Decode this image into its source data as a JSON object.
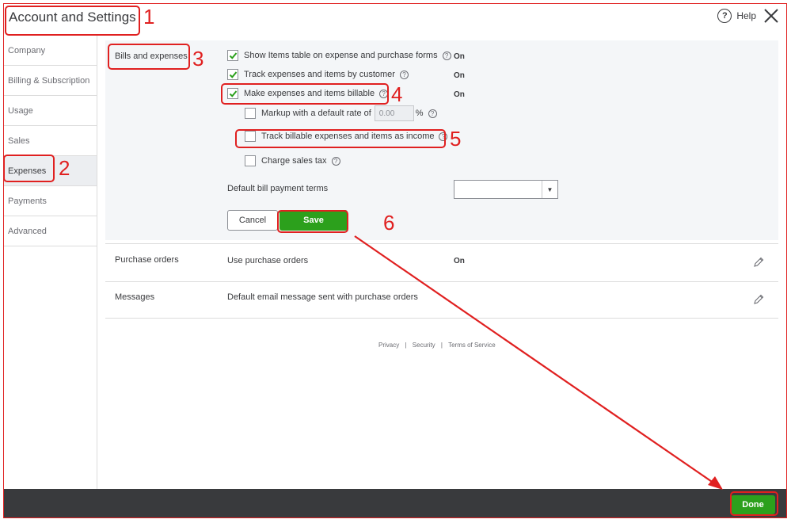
{
  "header": {
    "title": "Account and Settings",
    "help_label": "Help"
  },
  "sidebar": {
    "items": [
      {
        "label": "Company"
      },
      {
        "label": "Billing & Subscription"
      },
      {
        "label": "Usage"
      },
      {
        "label": "Sales"
      },
      {
        "label": "Expenses"
      },
      {
        "label": "Payments"
      },
      {
        "label": "Advanced"
      }
    ]
  },
  "bills": {
    "section_label": "Bills and expenses",
    "show_items": {
      "label": "Show Items table on expense and purchase forms",
      "status": "On",
      "checked": true
    },
    "track_by_customer": {
      "label": "Track expenses and items by customer",
      "status": "On",
      "checked": true
    },
    "make_billable": {
      "label": "Make expenses and items billable",
      "status": "On",
      "checked": true
    },
    "markup": {
      "label": "Markup with a default rate of",
      "value": "0.00",
      "unit": "%",
      "checked": false
    },
    "track_as_income": {
      "label": "Track billable expenses and items as income",
      "checked": false
    },
    "charge_tax": {
      "label": "Charge sales tax",
      "checked": false
    },
    "payment_terms": {
      "label": "Default bill payment terms",
      "value": ""
    },
    "cancel_label": "Cancel",
    "save_label": "Save"
  },
  "purchase_orders": {
    "section_label": "Purchase orders",
    "label": "Use purchase orders",
    "status": "On"
  },
  "messages": {
    "section_label": "Messages",
    "label": "Default email message sent with purchase orders"
  },
  "footer": {
    "privacy": "Privacy",
    "sep": "|",
    "security": "Security",
    "terms": "Terms of Service"
  },
  "bottom": {
    "done_label": "Done"
  },
  "annotations": {
    "n1": "1",
    "n2": "2",
    "n3": "3",
    "n4": "4",
    "n5": "5",
    "n6": "6"
  },
  "colors": {
    "accent_green": "#2ca01c",
    "annotation_red": "#e02020",
    "bottom_bar": "#393a3d"
  }
}
